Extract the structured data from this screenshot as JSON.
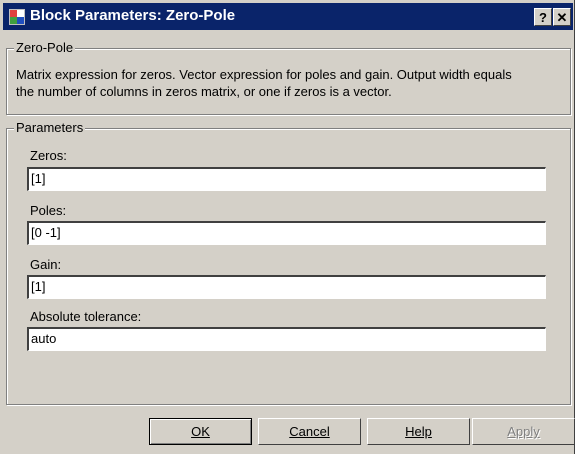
{
  "window": {
    "title": "Block Parameters: Zero-Pole",
    "help_glyph": "?",
    "close_glyph": "✕",
    "icon": "simulink-block-icon"
  },
  "block_group": {
    "label": "Zero-Pole",
    "description_line1": "Matrix expression for zeros.  Vector expression for poles and gain.  Output width equals",
    "description_line2": "the number of columns in zeros matrix, or one if zeros is a vector."
  },
  "params_group": {
    "label": "Parameters",
    "fields": [
      {
        "label": "Zeros:",
        "value": "[1]"
      },
      {
        "label": "Poles:",
        "value": "[0 -1]"
      },
      {
        "label": "Gain:",
        "value": "[1]"
      },
      {
        "label": "Absolute tolerance:",
        "value": "auto"
      }
    ]
  },
  "buttons": {
    "ok_label": "OK",
    "cancel_label": "Cancel",
    "help_label": "Help",
    "apply_label": "Apply"
  }
}
